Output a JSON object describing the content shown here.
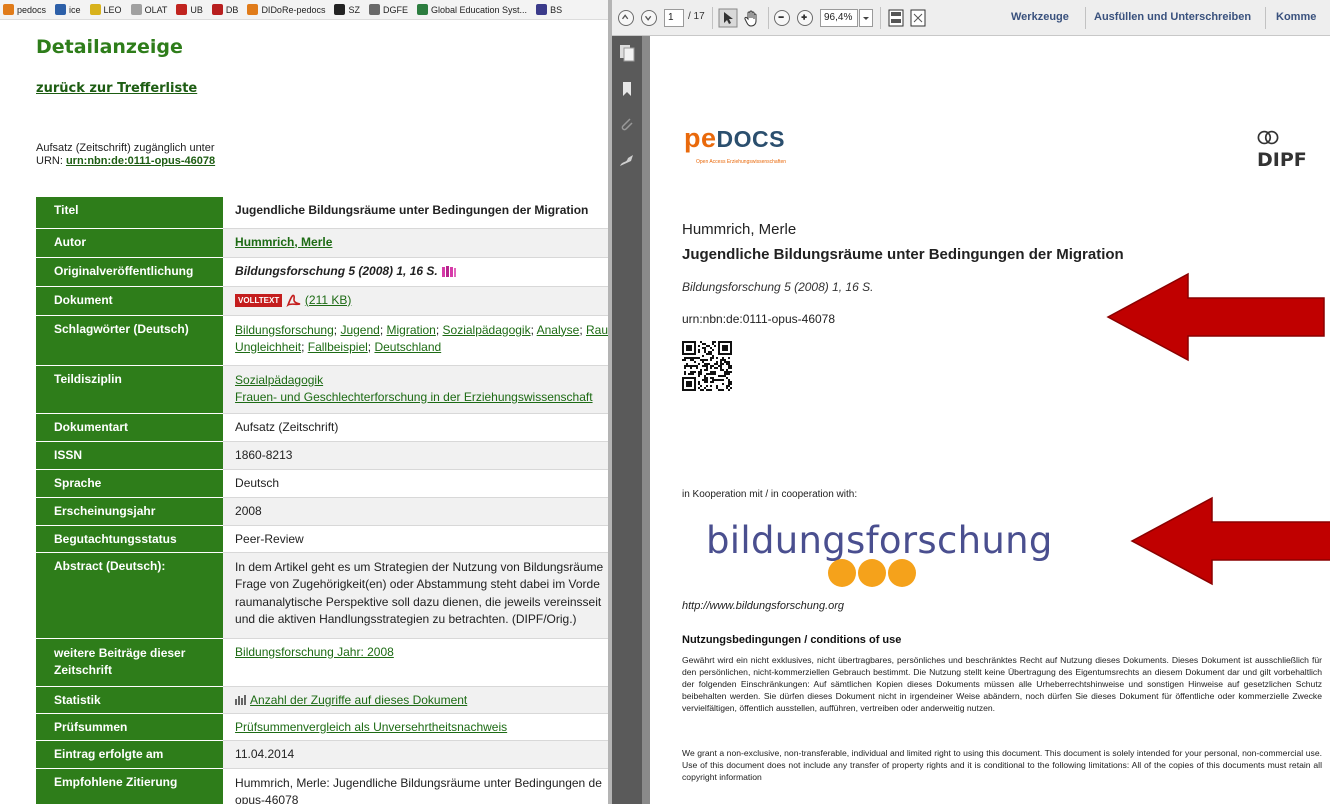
{
  "bookmarks": [
    {
      "label": "pedocs",
      "color": "#e07b1a"
    },
    {
      "label": "ice",
      "color": "#2c5fa8"
    },
    {
      "label": "LEO",
      "color": "#d8b21c"
    },
    {
      "label": "OLAT",
      "color": "#a0a0a0"
    },
    {
      "label": "UB",
      "color": "#c0231e"
    },
    {
      "label": "DB",
      "color": "#b81e1e"
    },
    {
      "label": "DIDoRe-pedocs",
      "color": "#e07b1a"
    },
    {
      "label": "SZ",
      "color": "#222222"
    },
    {
      "label": "DGFE",
      "color": "#6a6a6a"
    },
    {
      "label": "Global Education Syst...",
      "color": "#2c7d3f"
    },
    {
      "label": "BS",
      "color": "#3a3a8a"
    }
  ],
  "detail": {
    "title": "Detailanzeige",
    "back_link": "zurück zur Trefferliste",
    "access_line": "Aufsatz (Zeitschrift) zugänglich unter",
    "urn_label": "URN: ",
    "urn_link": "urn:nbn:de:0111-opus-46078",
    "rows": {
      "titel": {
        "key": "Titel",
        "value": "Jugendliche Bildungsräume unter Bedingungen der Migration"
      },
      "autor": {
        "key": "Autor",
        "value": "Hummrich, Merle"
      },
      "original": {
        "key": "Originalveröffentlichung",
        "value": "Bildungsforschung 5 (2008) 1, 16 S."
      },
      "dokument": {
        "key": "Dokument",
        "badge": "VOLLTEXT",
        "size": "(211 KB)"
      },
      "schlagwoerter": {
        "key": "Schlagwörter (Deutsch)",
        "line1": [
          "Bildungsforschung",
          "Jugend",
          "Migration",
          "Sozialpädagogik",
          "Analyse",
          "Rau"
        ],
        "line2": [
          "Ungleichheit",
          "Fallbeispiel",
          "Deutschland"
        ]
      },
      "teildisziplin": {
        "key": "Teildisziplin",
        "line1": "Sozialpädagogik",
        "line2": "Frauen- und Geschlechterforschung in der Erziehungswissenschaft"
      },
      "dokumentart": {
        "key": "Dokumentart",
        "value": "Aufsatz (Zeitschrift)"
      },
      "issn": {
        "key": "ISSN",
        "value": "1860-8213"
      },
      "sprache": {
        "key": "Sprache",
        "value": "Deutsch"
      },
      "jahr": {
        "key": "Erscheinungsjahr",
        "value": "2008"
      },
      "begutachtung": {
        "key": "Begutachtungsstatus",
        "value": "Peer-Review"
      },
      "abstract": {
        "key": "Abstract (Deutsch):",
        "lines": [
          "In dem Artikel geht es um Strategien der Nutzung von Bildungsräume",
          "Frage von Zugehörigkeit(en) oder Abstammung steht dabei im Vorde",
          "raumanalytische Perspektive soll dazu dienen, die jeweils vereinsseit",
          "und die aktiven Handlungsstrategien zu betrachten. (DIPF/Orig.)"
        ]
      },
      "weitere": {
        "key_line1": "weitere Beiträge dieser",
        "key_line2": "Zeitschrift",
        "value": "Bildungsforschung Jahr: 2008"
      },
      "statistik": {
        "key": "Statistik",
        "value": "Anzahl der Zugriffe auf dieses Dokument"
      },
      "pruefsummen": {
        "key": "Prüfsummen",
        "value": "Prüfsummenvergleich als Unversehrtheitsnachweis"
      },
      "eintrag": {
        "key": "Eintrag erfolgte am",
        "value": "11.04.2014"
      },
      "zitierung": {
        "key": "Empfohlene Zitierung",
        "line1": "Hummrich, Merle: Jugendliche Bildungsräume unter Bedingungen de",
        "line2": "opus-46078"
      }
    }
  },
  "pdf_toolbar": {
    "page_value": "1",
    "page_total": "/ 17",
    "zoom": "96,4%",
    "menu": [
      "Werkzeuge",
      "Ausfüllen und Unterschreiben",
      "Komme"
    ]
  },
  "pdf_page": {
    "logo_pe": "pe",
    "logo_docs": "DOCS",
    "logo_tagline": "Open Access Erziehungswissenschaften",
    "dipf": "DIPF",
    "author": "Hummrich, Merle",
    "title": "Jugendliche Bildungsräume unter Bedingungen der Migration",
    "citation": "Bildungsforschung 5 (2008) 1, 16 S.",
    "urn": "urn:nbn:de:0111-opus-46078",
    "cooperation": "in Kooperation mit / in cooperation with:",
    "partner_logo": "bildungsforschung",
    "partner_url": "http://www.bildungsforschung.org",
    "conditions_heading": "Nutzungsbedingungen / conditions of use",
    "conditions_de": "Gewährt wird ein nicht exklusives, nicht übertragbares, persönliches und beschränktes Recht auf Nutzung dieses Dokuments. Dieses Dokument ist ausschließlich für den persönlichen, nicht-kommerziellen Gebrauch bestimmt. Die Nutzung stellt keine Übertragung des Eigentumsrechts an diesem Dokument dar und gilt vorbehaltlich der folgenden Einschränkungen: Auf sämtlichen Kopien dieses Dokuments müssen alle Urheberrechtshinweise und sonstigen Hinweise auf gesetzlichen Schutz beibehalten werden. Sie dürfen dieses Dokument nicht in irgendeiner Weise abändern, noch dürfen Sie dieses Dokument für öffentliche oder kommerzielle Zwecke vervielfältigen, öffentlich ausstellen, aufführen, vertreiben oder anderweitig nutzen.",
    "conditions_en": "We grant a non-exclusive, non-transferable, individual and limited right to using this document. This document is solely intended for your personal, non-commercial use. Use of this document does not include any transfer of property rights and it is conditional to the following limitations: All of the copies of this documents must retain all copyright information"
  },
  "colors": {
    "brand_green": "#2e7d1a",
    "pedocs_orange": "#e9690b",
    "arrow_red": "#c00000"
  }
}
